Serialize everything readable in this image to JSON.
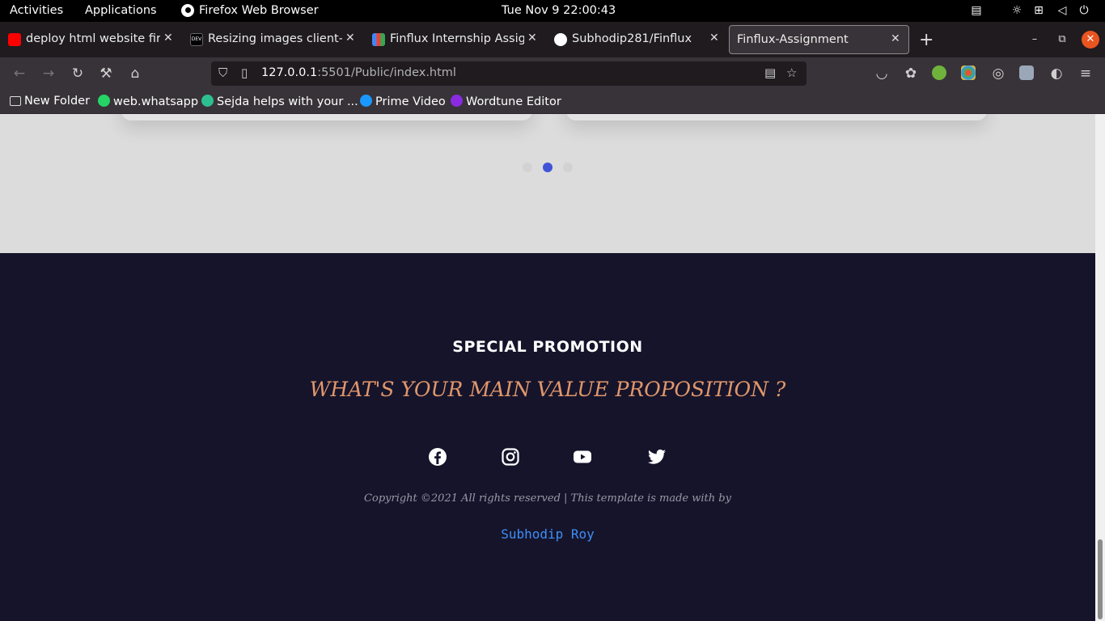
{
  "system_bar": {
    "activities": "Activities",
    "applications": "Applications",
    "app_name": "Firefox Web Browser",
    "clock": "Tue Nov 9  22:00:43"
  },
  "tabs": [
    {
      "title": "deploy html website firebase",
      "favicon": "youtube-icon",
      "color": "#ff0000"
    },
    {
      "title": "Resizing images client-side",
      "favicon": "dev-icon",
      "color": "#000000"
    },
    {
      "title": "Finflux Internship Assignment",
      "favicon": "gmail-icon",
      "color": "#ea4335"
    },
    {
      "title": "Subhodip281/Finflux",
      "favicon": "github-icon",
      "color": "#ffffff"
    },
    {
      "title": "Finflux-Assignment",
      "favicon": "none",
      "active": true
    }
  ],
  "url": {
    "host": "127.0.0.1",
    "rest": ":5501/Public/index.html"
  },
  "bookmarks": [
    {
      "label": "New Folder",
      "icon": "folder-icon",
      "color": "#dddddd"
    },
    {
      "label": "web.whatsapp",
      "icon": "whatsapp-icon",
      "color": "#25d366"
    },
    {
      "label": "Sejda helps with your ...",
      "icon": "sejda-icon",
      "color": "#2ebf91"
    },
    {
      "label": "Prime Video",
      "icon": "prime-video-icon",
      "color": "#1a98ff"
    },
    {
      "label": "Wordtune Editor",
      "icon": "wordtune-icon",
      "color": "#8a2be2"
    }
  ],
  "carousel": {
    "active_dot": 1,
    "dot_count": 3,
    "active_color": "#4053d6",
    "inactive_color": "#d2d2d2"
  },
  "footer": {
    "title": "SPECIAL PROMOTION",
    "subtitle": "WHAT'S YOUR MAIN VALUE PROPOSITION ?",
    "social": [
      "facebook-icon",
      "instagram-icon",
      "youtube-icon",
      "twitter-icon"
    ],
    "copyright": "Copyright ©2021 All rights reserved | This template is made with by",
    "author": "Subhodip Roy",
    "accent": "#e1976b",
    "link_color": "#3d8ef6",
    "background": "#16142b"
  }
}
